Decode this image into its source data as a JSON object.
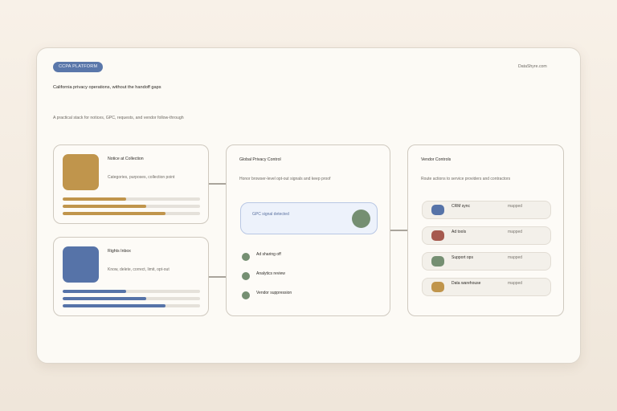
{
  "header": {
    "badge": "CCPA PLATFORM",
    "brand": "DataShyre.com",
    "headline": "California privacy operations, without the handoff gaps",
    "subline": "A practical stack for notices, GPC, requests, and vendor follow-through"
  },
  "notice_card": {
    "title": "Notice at Collection",
    "subtitle": "Categories, purposes, collection point",
    "color": "#c0954c",
    "progress": [
      0.46,
      0.61,
      0.75
    ]
  },
  "rights_card": {
    "title": "Rights Inbox",
    "subtitle": "Know, delete, correct, limit, opt-out",
    "color": "#5673a8",
    "progress": [
      0.46,
      0.61,
      0.75
    ]
  },
  "gpc_card": {
    "title": "Global Privacy Control",
    "subtitle": "Honor browser-level opt-out signals and keep proof",
    "signal_label": "GPC signal detected",
    "items": [
      {
        "label": "Ad sharing off"
      },
      {
        "label": "Analytics review"
      },
      {
        "label": "Vendor suppression"
      }
    ]
  },
  "vendor_card": {
    "title": "Vendor Controls",
    "subtitle": "Route actions to service providers and contractors",
    "vendors": [
      {
        "name": "CRM sync",
        "status": "mapped",
        "color": "#5673a8"
      },
      {
        "name": "Ad tools",
        "status": "mapped",
        "color": "#a65a4f"
      },
      {
        "name": "Support ops",
        "status": "mapped",
        "color": "#758f72"
      },
      {
        "name": "Data warehouse",
        "status": "mapped",
        "color": "#c0954c"
      }
    ]
  }
}
